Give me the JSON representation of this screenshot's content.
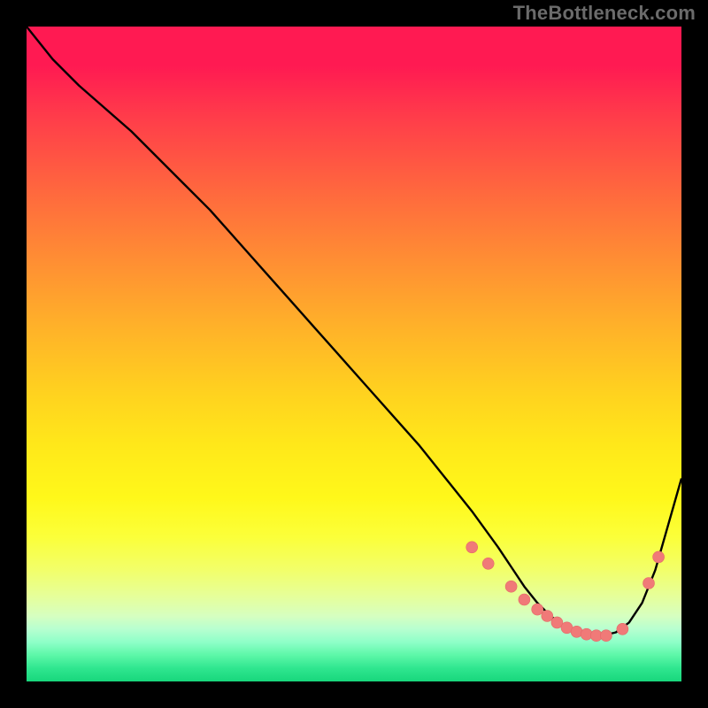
{
  "watermark": "TheBottleneck.com",
  "colors": {
    "background": "#000000",
    "curve_stroke": "#000000",
    "point_fill": "#f07a78",
    "gradient_top": "#ff1a52",
    "gradient_mid": "#ffe81a",
    "gradient_bottom": "#18d77c"
  },
  "chart_data": {
    "type": "line",
    "title": "",
    "xlabel": "",
    "ylabel": "",
    "xlim": [
      0,
      100
    ],
    "ylim": [
      0,
      100
    ],
    "grid": false,
    "legend": null,
    "series": [
      {
        "name": "bottleneck-curve",
        "x": [
          0,
          4,
          8,
          12,
          16,
          20,
          24,
          28,
          32,
          36,
          40,
          44,
          48,
          52,
          56,
          60,
          64,
          68,
          72,
          74,
          76,
          78,
          80,
          82,
          84,
          86,
          88,
          90,
          92,
          94,
          96,
          98,
          100
        ],
        "y": [
          100,
          95,
          91,
          87.5,
          84,
          80,
          76,
          72,
          67.5,
          63,
          58.5,
          54,
          49.5,
          45,
          40.5,
          36,
          31,
          26,
          20.5,
          17.5,
          14.5,
          12,
          10,
          8.5,
          7.5,
          7,
          7,
          7.5,
          9,
          12,
          17,
          24,
          31
        ]
      }
    ],
    "markers": {
      "name": "highlight-points",
      "x": [
        68,
        70.5,
        74,
        76,
        78,
        79.5,
        81,
        82.5,
        84,
        85.5,
        87,
        88.5,
        91,
        95,
        96.5
      ],
      "y": [
        20.5,
        18,
        14.5,
        12.5,
        11,
        10,
        9,
        8.2,
        7.6,
        7.2,
        7,
        7,
        8,
        15,
        19
      ]
    }
  }
}
